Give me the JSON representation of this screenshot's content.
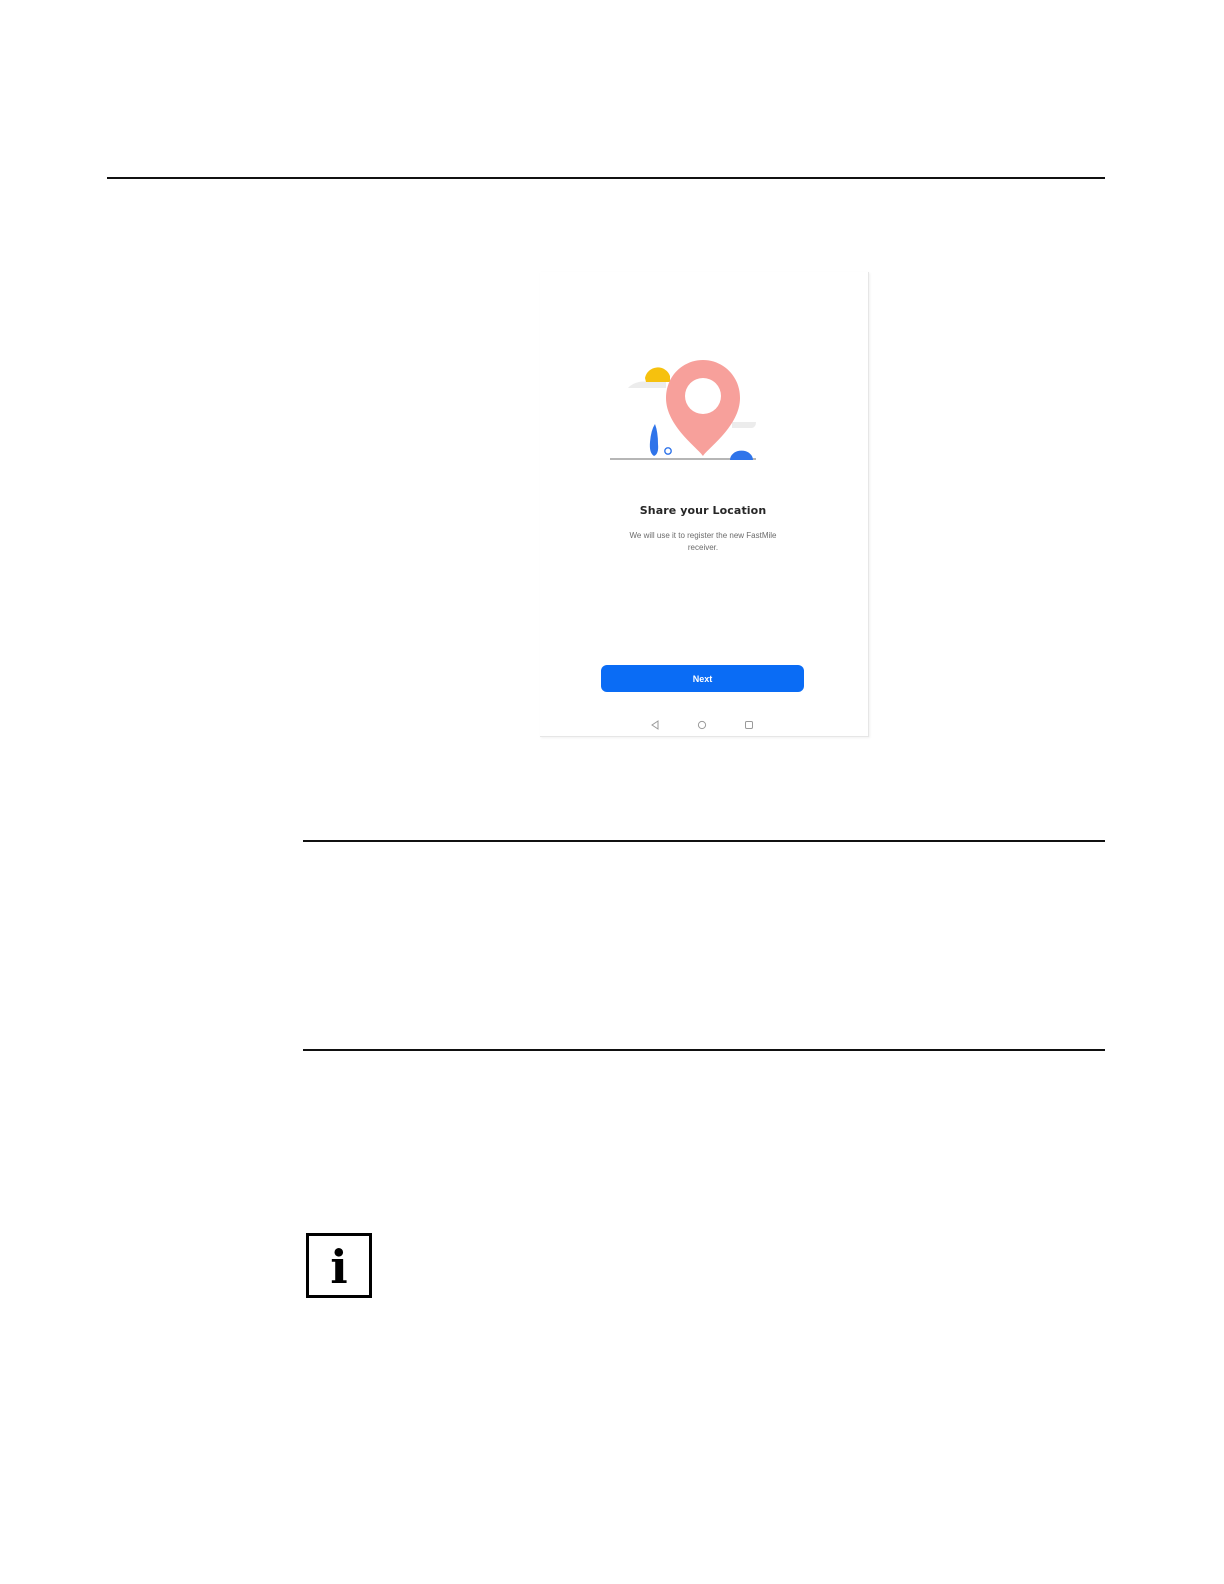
{
  "screen": {
    "title": "Share your Location",
    "description": "We will use it to register the new FastMile receiver.",
    "next_label": "Next"
  },
  "icons": {
    "illustration": "location-pin-illustration",
    "back": "back-triangle-icon",
    "home": "home-circle-icon",
    "recent": "recent-apps-square-icon",
    "note": "info-icon"
  },
  "note_icon_glyph": "i",
  "colors": {
    "accent": "#0a6cf5",
    "pin": "#f7a09b",
    "sun": "#f6c10e",
    "rule": "#111111"
  }
}
